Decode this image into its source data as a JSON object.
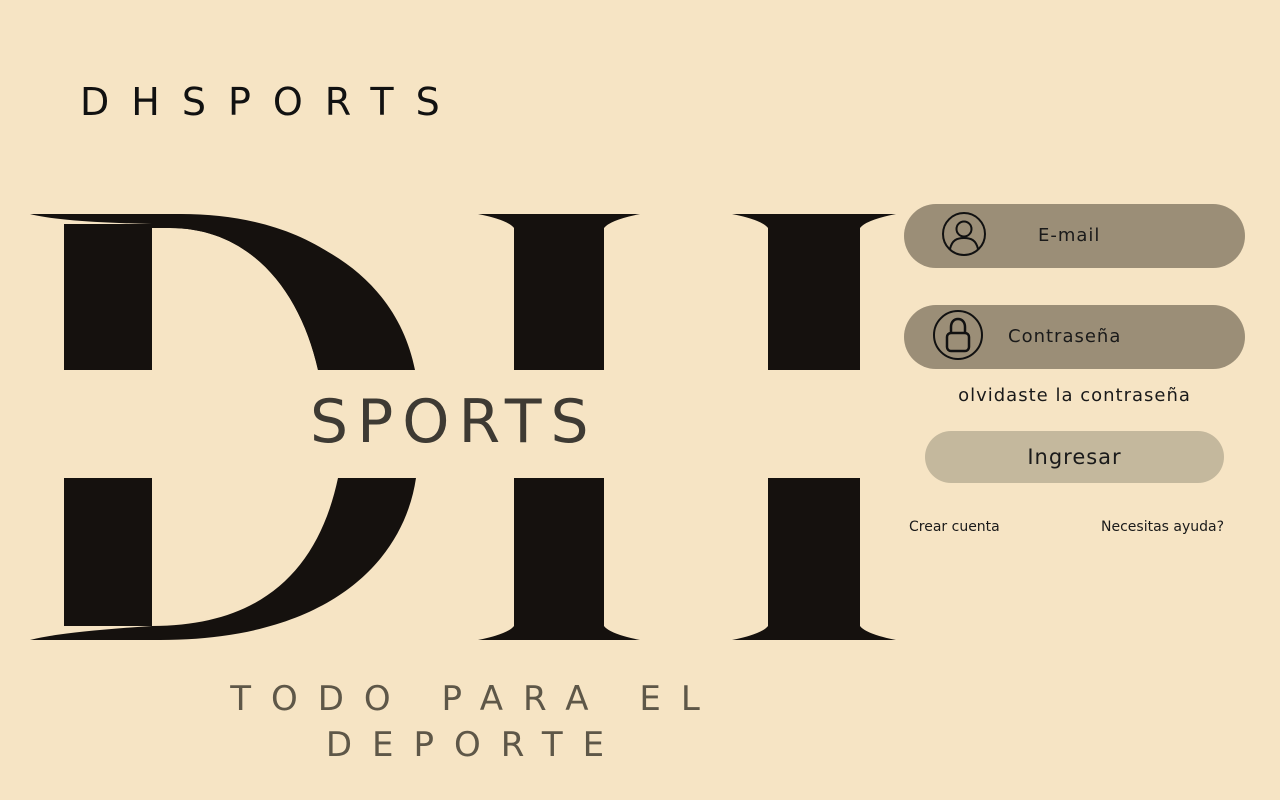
{
  "header": {
    "brand": "DHSPORTS"
  },
  "logo": {
    "letters": "DH",
    "word": "SPORTS",
    "tagline_line1": "TODO PARA EL",
    "tagline_line2": "DEPORTE"
  },
  "login": {
    "email_placeholder": "E-mail",
    "email_icon": "user-circle-icon",
    "password_placeholder": "Contraseña",
    "password_icon": "lock-icon",
    "forgot_label": "olvidaste la contraseña",
    "submit_label": "Ingresar",
    "create_account_label": "Crear cuenta",
    "help_label": "Necesitas ayuda?"
  },
  "colors": {
    "background": "#f6e4c4",
    "field": "#9b8e77",
    "button": "#c4b89d",
    "logo_ink": "#15110e"
  }
}
